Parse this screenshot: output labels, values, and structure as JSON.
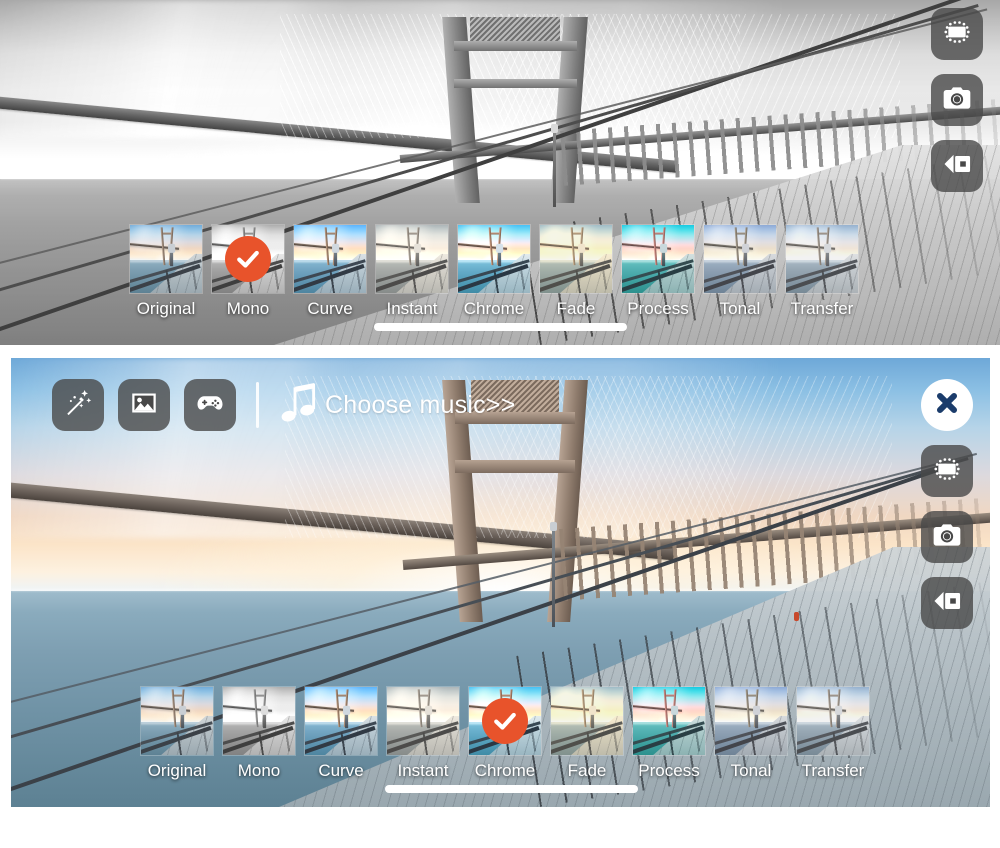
{
  "app": {
    "accent_color": "#e8532b",
    "button_bg": "#484848",
    "close_icon_color": "#1b3c6b"
  },
  "toolbar": {
    "effects_label": "magic-wand",
    "gallery_label": "image",
    "games_label": "gamepad",
    "music_icon": "music-note-icon",
    "music_label": "Choose music>>"
  },
  "side_buttons": {
    "close_label": "close-icon",
    "rotate_label": "rotate-frame-icon",
    "camera_label": "camera-icon",
    "video_label": "video-camera-icon"
  },
  "filters": {
    "items": [
      {
        "label": "Original",
        "look": "f-original"
      },
      {
        "label": "Mono",
        "look": "f-mono"
      },
      {
        "label": "Curve",
        "look": "f-curve"
      },
      {
        "label": "Instant",
        "look": "f-instant"
      },
      {
        "label": "Chrome",
        "look": "f-chrome"
      },
      {
        "label": "Fade",
        "look": "f-fade"
      },
      {
        "label": "Process",
        "look": "f-process"
      },
      {
        "label": "Tonal",
        "look": "f-tonal"
      },
      {
        "label": "Transfer",
        "look": "f-transfer"
      }
    ],
    "top_panel_selected": "Mono",
    "bottom_panel_selected": "Chrome",
    "top_panel_selected_index": 1,
    "bottom_panel_selected_index": 4
  },
  "panels": {
    "top": {
      "name": "photo-preview-mono",
      "applied_filter": "Mono",
      "scene": "suspension bridge and wooden pier over water"
    },
    "bottom": {
      "name": "photo-preview-chrome",
      "applied_filter": "Chrome",
      "scene": "suspension bridge and wooden pier over water"
    }
  }
}
